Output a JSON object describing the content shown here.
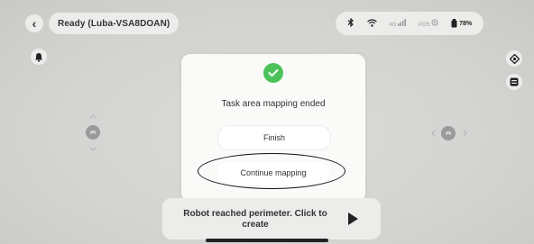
{
  "topbar": {
    "back_glyph": "‹",
    "status_text": "Ready  (Luba-VSA8DOAN)"
  },
  "connection": {
    "bluetooth_icon": "bluetooth-icon",
    "wifi_icon": "wifi-icon",
    "cellular_label": "4G",
    "pos_label": "POS",
    "battery_percent": "78%"
  },
  "dialog": {
    "title": "Task area mapping ended",
    "finish_label": "Finish",
    "continue_label": "Continue mapping"
  },
  "toast": {
    "line1": "Robot reached perimeter. Click to",
    "line2": "create"
  }
}
